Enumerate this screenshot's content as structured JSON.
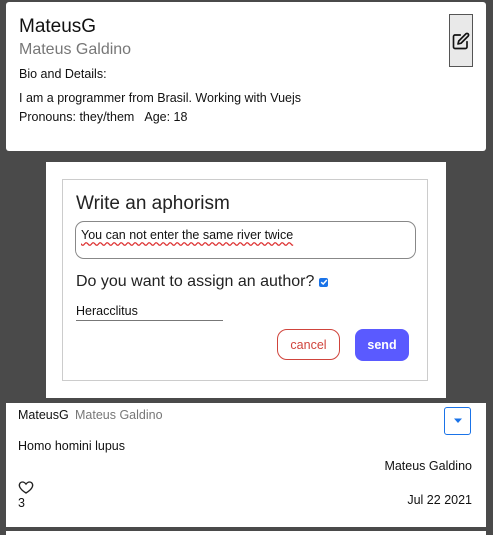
{
  "profile": {
    "username": "MateusG",
    "full_name": "Mateus Galdino",
    "bio_label": "Bio and Details:",
    "bio_text": "I am a programmer from Brasil. Working with Vuejs",
    "pronouns": "Pronouns: they/them",
    "age": "Age: 18",
    "edit_icon": "edit-icon"
  },
  "compose": {
    "title": "Write an aphorism",
    "aphorism_value": "You can not enter the same river twice",
    "assign_label": "Do you want to assign an author?",
    "assign_checked": true,
    "author_value": "Heracclitus",
    "cancel_label": "cancel",
    "send_label": "send",
    "colors": {
      "cancel": "#d0443c",
      "send": "#5a5aff",
      "checkbox": "#1a73e8"
    }
  },
  "aphorism_card": {
    "username": "MateusG",
    "full_name": "Mateus Galdino",
    "text": "Homo homini lupus",
    "author": "Mateus Galdino",
    "likes": "3",
    "date": "Jul 22 2021",
    "like_icon": "heart-icon",
    "menu_icon": "caret-down-icon"
  }
}
